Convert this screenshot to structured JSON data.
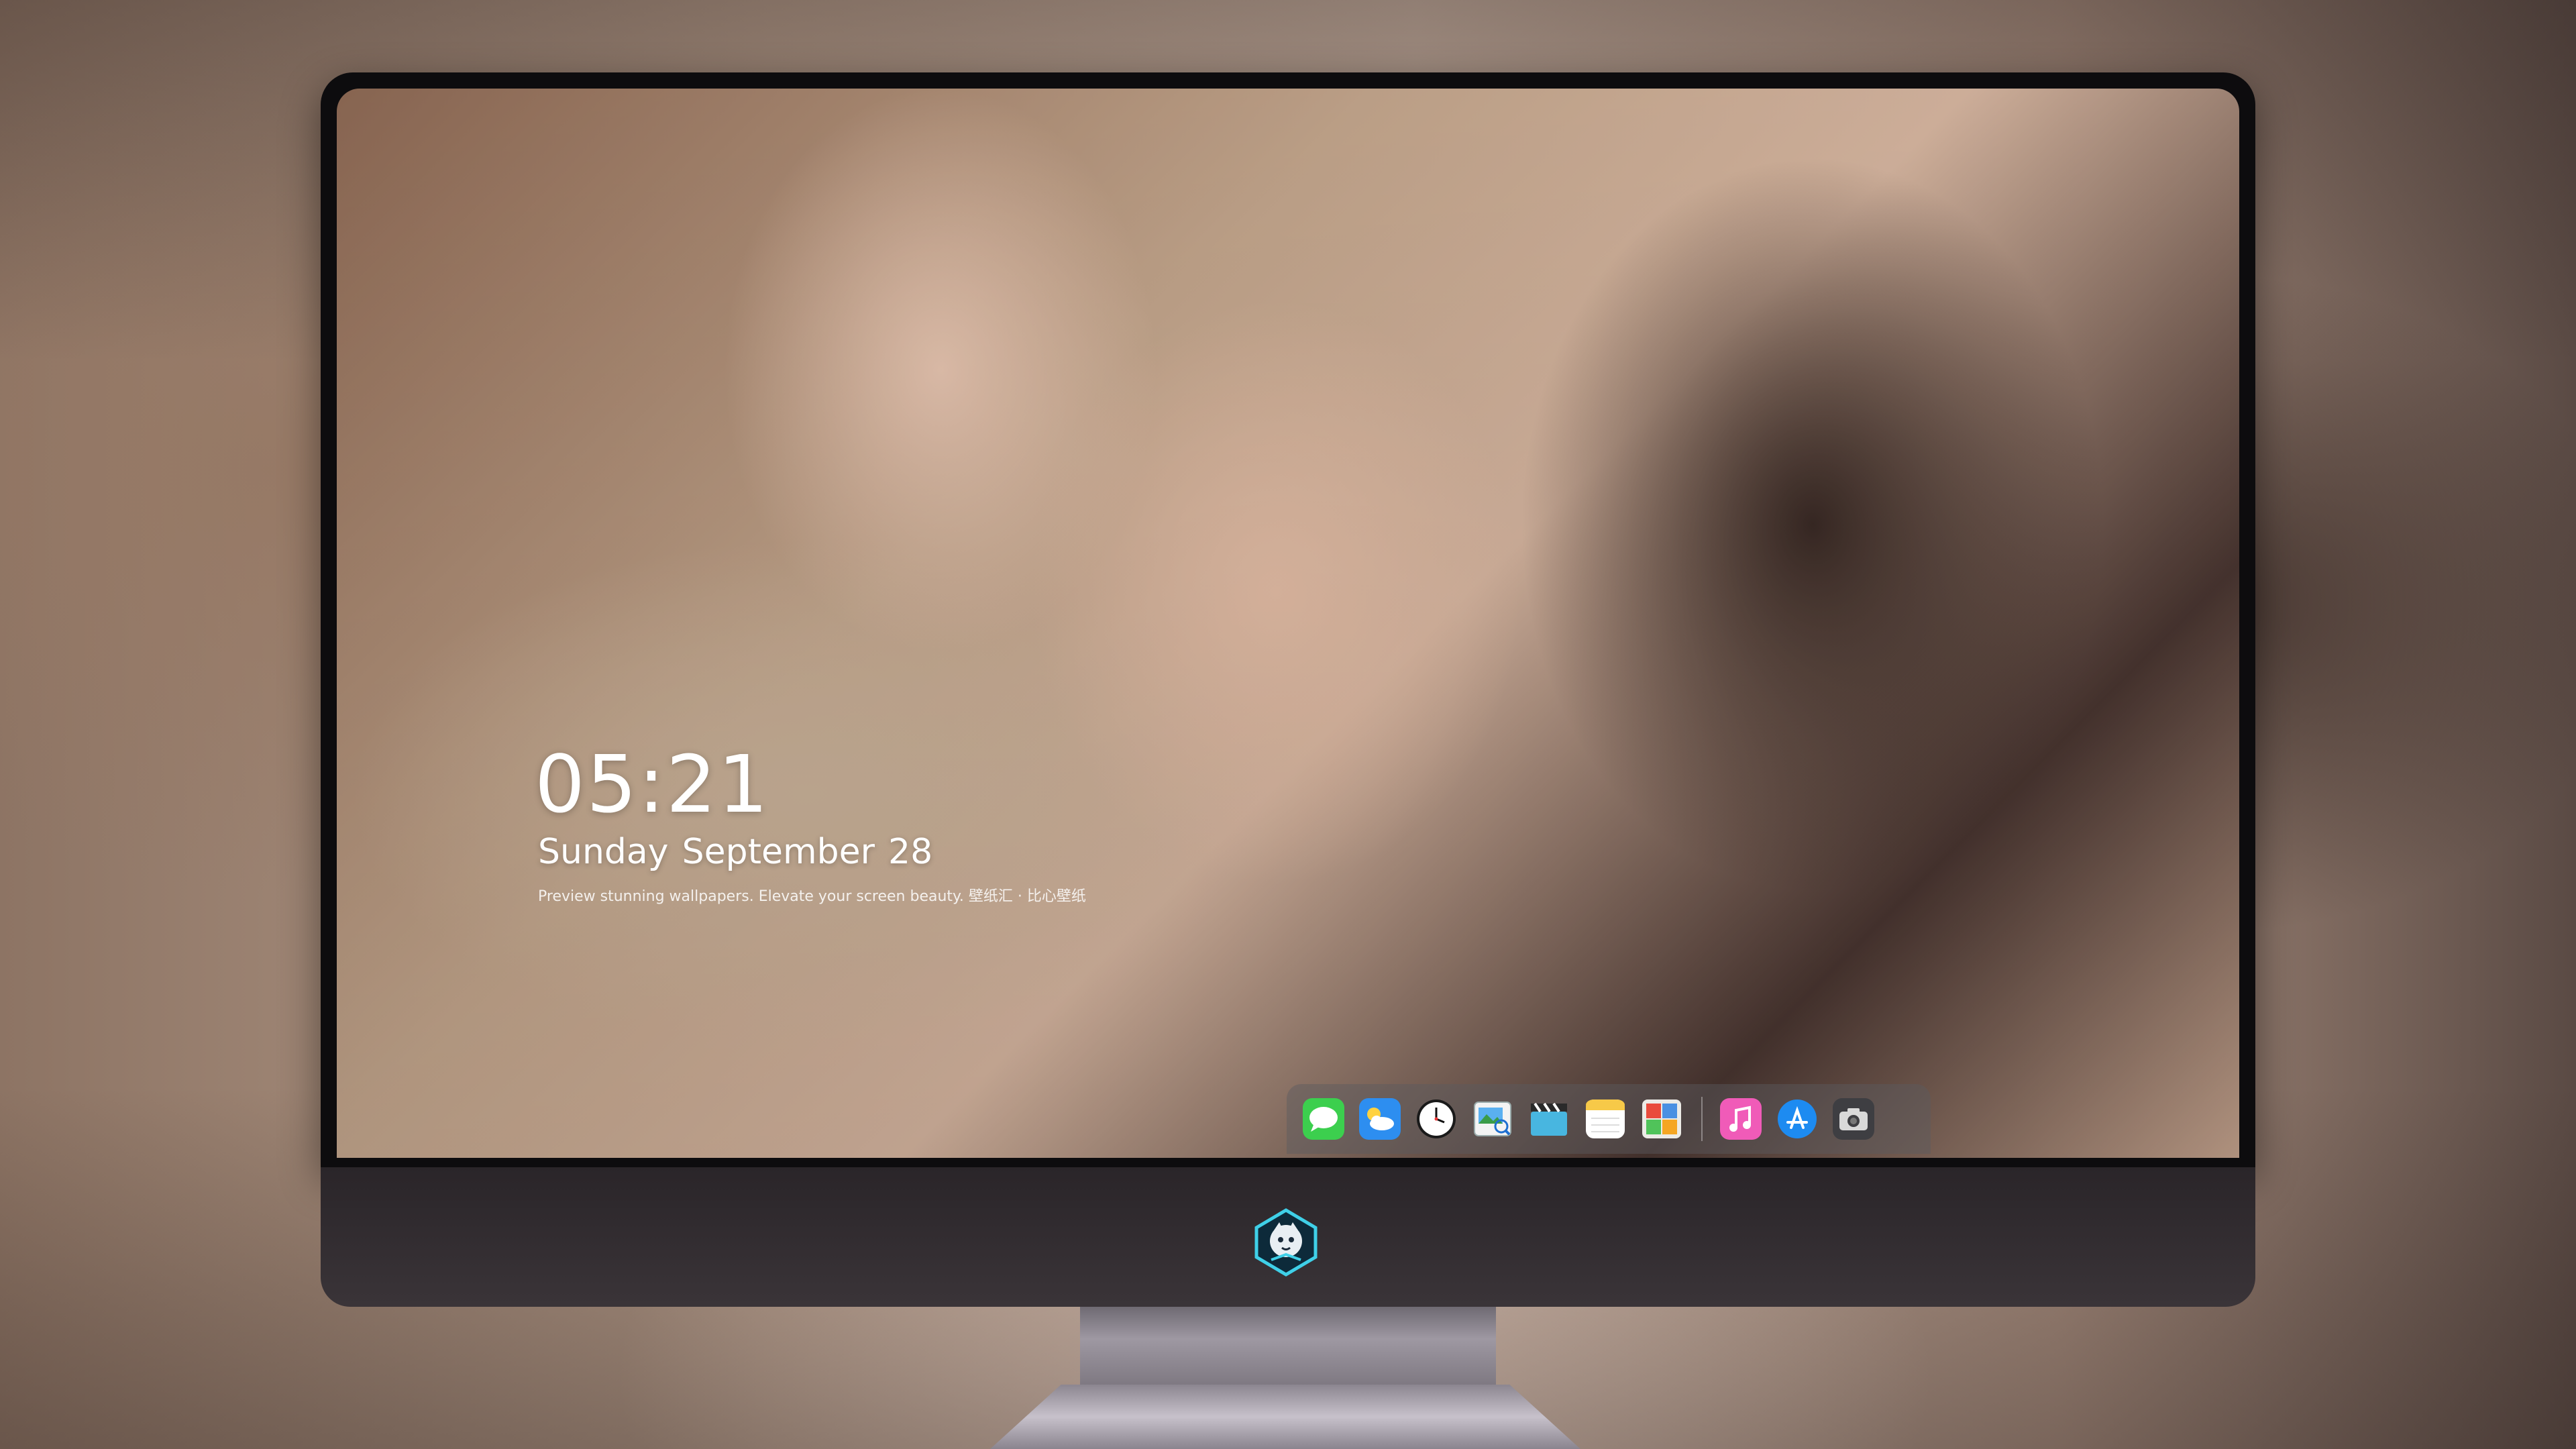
{
  "lockscreen": {
    "time": "05:21",
    "date": {
      "weekday": "Sunday",
      "month": "September",
      "day": "28"
    },
    "tagline": "Preview stunning wallpapers. Elevate your screen beauty. 壁纸汇 · 比心壁纸"
  },
  "dock": {
    "apps": [
      {
        "name": "Messages",
        "icon": "messages-icon"
      },
      {
        "name": "Weather",
        "icon": "weather-icon"
      },
      {
        "name": "Clock",
        "icon": "clock-icon"
      },
      {
        "name": "Preview",
        "icon": "preview-icon"
      },
      {
        "name": "Clips",
        "icon": "clapperboard-icon"
      },
      {
        "name": "Notes",
        "icon": "notes-icon"
      },
      {
        "name": "Photo Booth",
        "icon": "photo-booth-icon"
      },
      {
        "name": "iTunes",
        "icon": "music-note-icon"
      },
      {
        "name": "App Store",
        "icon": "app-store-icon"
      },
      {
        "name": "Camera",
        "icon": "camera-icon"
      }
    ]
  },
  "colors": {
    "bezel": "#0d0c0e",
    "chin": "#2f2a2e",
    "dock_bg": "rgba(90,90,95,0.45)",
    "text": "#ffffff"
  }
}
